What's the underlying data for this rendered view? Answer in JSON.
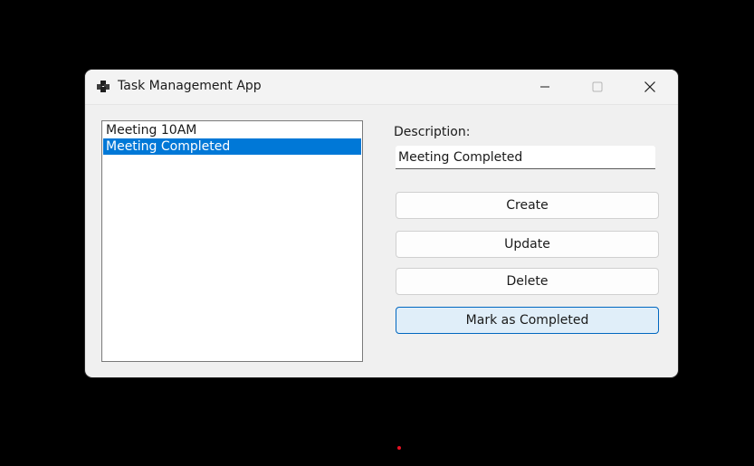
{
  "window": {
    "title": "Task Management App",
    "controls": {
      "minimize_icon": "minimize-icon",
      "maximize_icon": "maximize-icon",
      "close_icon": "close-icon"
    }
  },
  "task_list": {
    "items": [
      {
        "label": "Meeting 10AM",
        "selected": false
      },
      {
        "label": "Meeting Completed",
        "selected": true
      }
    ]
  },
  "form": {
    "description_label": "Description:",
    "description_value": "Meeting Completed"
  },
  "buttons": {
    "create": "Create",
    "update": "Update",
    "delete": "Delete",
    "mark_completed": "Mark as Completed"
  },
  "colors": {
    "selection": "#0078d7",
    "focused_button_border": "#0067c0",
    "focused_button_fill": "#e0eef9"
  }
}
